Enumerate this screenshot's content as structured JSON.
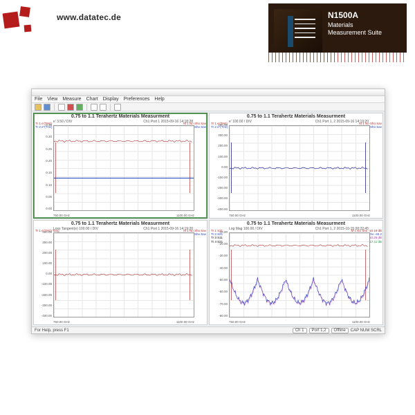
{
  "banner": {
    "url": "www.datatec.de",
    "product": {
      "model": "N1500A",
      "line1": "Materials",
      "line2": "Measurement Suite"
    }
  },
  "watermark": "www.datatec.de",
  "app": {
    "menu": [
      "File",
      "View",
      "Measure",
      "Chart",
      "Display",
      "Preferences",
      "Help"
    ],
    "status": {
      "left": "For Help, press F1",
      "right": [
        "Ch 1",
        "Port 1,2",
        "Offline",
        "CAP NUM SCRL"
      ]
    }
  },
  "chart_data": [
    {
      "type": "line",
      "title": "0.75 to 1.1 Terahertz Materials Measurment",
      "sub_left": "e' 3.50 / DIV",
      "sub_right": "Ch1   Port 1   2015-09-16 14:18:28",
      "legend_left": [
        {
          "cls": "r",
          "t": "Tr 1 e'(THz)"
        },
        {
          "cls": "b",
          "t": "Tr 2 e''(THz)"
        }
      ],
      "legend_right": [
        {
          "cls": "r",
          "t": "M 1 No Sho Sav"
        },
        {
          "cls": "b",
          "t": "M 2 No Sho Sav"
        }
      ],
      "xlim": [
        "750.00 GHz",
        "1100.00 GHz"
      ],
      "y_ticks": [
        "0.35",
        "0.30",
        "0.25",
        "0.20",
        "0.15",
        "0.10",
        "0.05",
        "0.00"
      ],
      "series": [
        {
          "name": "e'",
          "color": "#b03030",
          "shape": "noisy_flat",
          "y": 0.18
        },
        {
          "name": "e''",
          "color": "#2040c0",
          "shape": "flat",
          "y": 0.62
        }
      ]
    },
    {
      "type": "line",
      "title": "0.75 to 1.1 Terahertz Materials Measurment",
      "sub_left": "e' 100.00 / DIV",
      "sub_right": "Ch1   Port 1, 2   2015-09-16 14:19:20",
      "legend_left": [
        {
          "cls": "r",
          "t": "Tr 1 e'(THz)"
        },
        {
          "cls": "b",
          "t": "Tr 2 e''(THz)"
        }
      ],
      "legend_right": [
        {
          "cls": "r",
          "t": "M 1 No Sho Sav"
        },
        {
          "cls": "b",
          "t": "M 2 No Sho Sav"
        }
      ],
      "xlim": [
        "750.00 GHz",
        "1100.00 GHz"
      ],
      "y_ticks": [
        "400.00",
        "300.00",
        "200.00",
        "100.00",
        "0.00",
        "-100.00",
        "-200.00",
        "-300.00",
        "-400.00"
      ],
      "series": [
        {
          "name": "e'",
          "color": "#b03030",
          "shape": "noisy_flat",
          "y": 0.5
        },
        {
          "name": "e''",
          "color": "#2040c0",
          "shape": "noisy_flat",
          "y": 0.5
        }
      ]
    },
    {
      "type": "line",
      "title": "0.75 to 1.1 Terahertz Materials Measurment",
      "sub_left": "Loss Tangent(e) 100.00 / DIV",
      "sub_right": "Ch1   Port 1   2015-09-16 14:19:20",
      "legend_left": [
        {
          "cls": "r",
          "t": "Tr 1 e'(THz) Tang"
        }
      ],
      "legend_right": [
        {
          "cls": "r",
          "t": "M 1 No Sho Sav"
        },
        {
          "cls": "b",
          "t": "M 2 No Sho Sav"
        }
      ],
      "xlim": [
        "750.00 GHz",
        "1100.00 GHz"
      ],
      "y_ticks": [
        "400.00",
        "300.00",
        "200.00",
        "100.00",
        "0.00",
        "-100.00",
        "-200.00",
        "-300.00",
        "-400.00"
      ],
      "series": [
        {
          "name": "tan",
          "color": "#b03030",
          "shape": "noisy_flat",
          "y": 0.5
        }
      ]
    },
    {
      "type": "line",
      "title": "0.75 to 1.1 Terahertz Materials Measurment",
      "sub_left": "Log Mag 100.00 / DIV",
      "sub_right": "Ch1   Port 1, 2   2015-10-15 00:22:45",
      "legend_left": [
        {
          "cls": "r",
          "t": "Tr 1 S11"
        },
        {
          "cls": "b",
          "t": "Tr 2 S21"
        },
        {
          "cls": "m",
          "t": "Tr 3 S11"
        },
        {
          "cls": "g",
          "t": "Tr 4 S21"
        }
      ],
      "legend_right": [
        {
          "cls": "r",
          "t": "M 1 No Sho -10.18 dB"
        },
        {
          "cls": "b",
          "t": "M 2 No Sho -40.2"
        },
        {
          "cls": "m",
          "t": "M 3 No Sho -10.26 dB"
        },
        {
          "cls": "g",
          "t": "M 4 No Sho -17.11 dB"
        }
      ],
      "xlim": [
        "750.00 GHz",
        "1100.00 GHz"
      ],
      "y_ticks": [
        "-10.00",
        "-20.00",
        "-30.00",
        "-40.00",
        "-50.00",
        "-60.00",
        "-70.00",
        "-80.00"
      ],
      "series": [
        {
          "name": "S11",
          "color": "#b03030",
          "shape": "noisy_flat",
          "y": 0.15
        },
        {
          "name": "S21",
          "color": "#2040c0",
          "shape": "scallop",
          "y": 0.55
        }
      ]
    }
  ]
}
